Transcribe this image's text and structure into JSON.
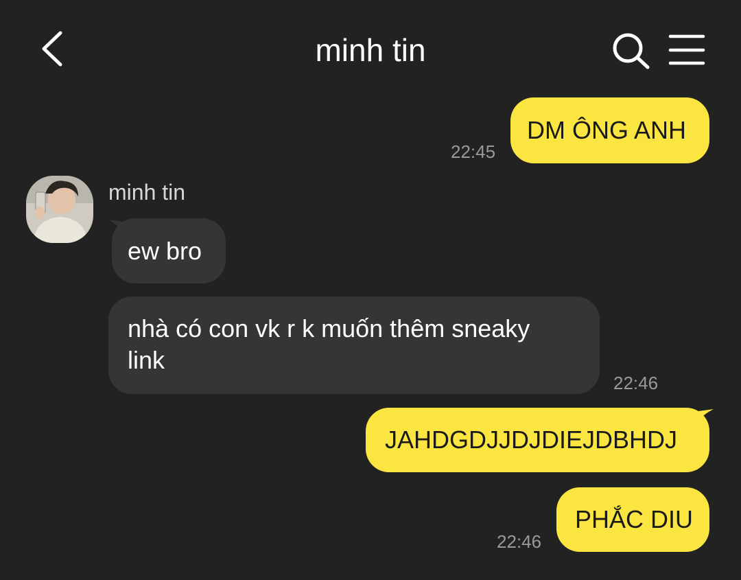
{
  "header": {
    "title": "minh tin",
    "back_icon": "chevron-left-icon",
    "search_icon": "search-icon",
    "menu_icon": "hamburger-menu-icon"
  },
  "sender": {
    "name": "minh tin"
  },
  "messages": [
    {
      "direction": "out",
      "text": "DM ÔNG ANH",
      "time": "22:45"
    },
    {
      "direction": "in",
      "text": "ew bro"
    },
    {
      "direction": "in",
      "text_line1": "nhà có con vk r k muốn thêm sneaky",
      "text_line2": "link",
      "time": "22:46"
    },
    {
      "direction": "out",
      "text": "JAHDGDJJDJDIEJDBHDJ"
    },
    {
      "direction": "out",
      "text": "PHẮC DIU",
      "time": "22:46"
    }
  ],
  "colors": {
    "background": "#222222",
    "outgoing_bubble": "#fbe641",
    "incoming_bubble": "#353535",
    "timestamp": "#9a9a9a"
  }
}
